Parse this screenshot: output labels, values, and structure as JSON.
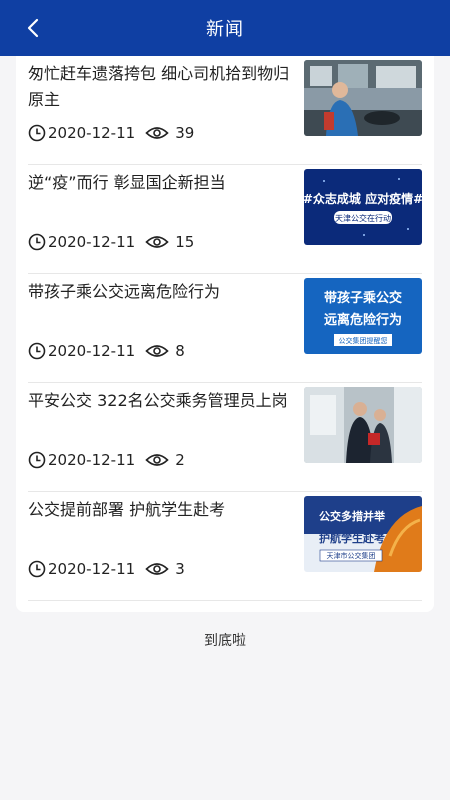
{
  "header": {
    "title": "新闻"
  },
  "news": [
    {
      "headline": "匆忙赶车遗落挎包 细心司机拾到物归原主",
      "date": "2020-12-11",
      "views": "39"
    },
    {
      "headline": "逆“疫”而行 彰显国企新担当",
      "date": "2020-12-11",
      "views": "15",
      "thumb_text": [
        "#众志成城 应对疫情#",
        "天津公交在行动"
      ]
    },
    {
      "headline": "带孩子乘公交远离危险行为",
      "date": "2020-12-11",
      "views": "8",
      "thumb_text": [
        "带孩子乘公交",
        "远离危险行为",
        "公交集团提醒您"
      ]
    },
    {
      "headline": "平安公交 322名公交乘务管理员上岗",
      "date": "2020-12-11",
      "views": "2"
    },
    {
      "headline": "公交提前部署 护航学生赴考",
      "date": "2020-12-11",
      "views": "3",
      "thumb_text": [
        "公交多措并举",
        "护航学生赴考",
        "天津市公交集团"
      ]
    }
  ],
  "footer": {
    "end_text": "到底啦"
  },
  "colors": {
    "header_bg": "#0f3fa3",
    "card_bg": "#ffffff",
    "page_bg": "#f5f5f7"
  }
}
